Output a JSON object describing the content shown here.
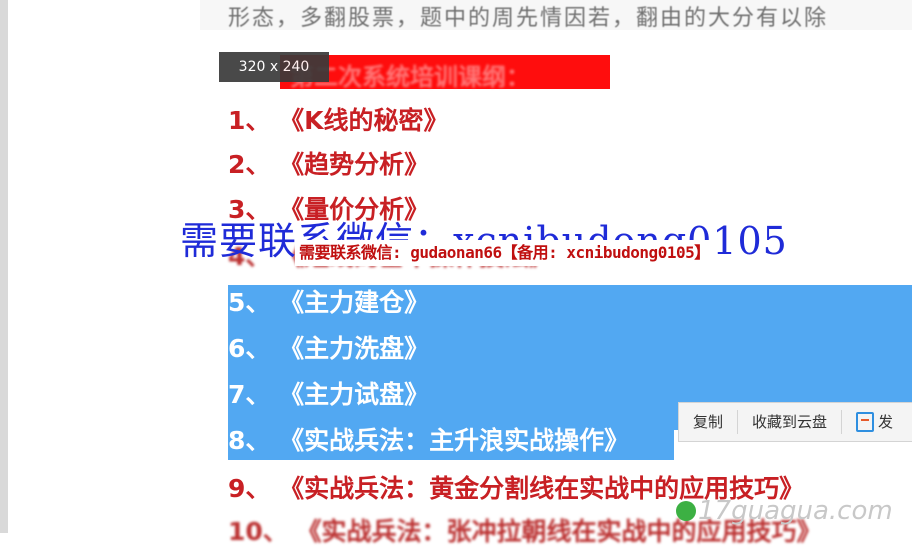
{
  "top_line": "形态，多翻股票，题中的周先情因若，翻由的大分有以除",
  "size_tag": "320 x 240",
  "outline_title": "第二次系统培训课纲：",
  "outline": [
    {
      "num": "1、",
      "title": "《K线的秘密》"
    },
    {
      "num": "2、",
      "title": "《趋势分析》"
    },
    {
      "num": "3、",
      "title": "《量价分析》"
    },
    {
      "num": "4、",
      "title": "《短线的基本操作技法》"
    },
    {
      "num": "5、",
      "title": "《主力建仓》"
    },
    {
      "num": "6、",
      "title": "《主力洗盘》"
    },
    {
      "num": "7、",
      "title": "《主力试盘》"
    },
    {
      "num": "8、",
      "title": "《实战兵法：主升浪实战操作》"
    },
    {
      "num": "9、",
      "title": "《实战兵法：黄金分割线在实战中的应用技巧》"
    },
    {
      "num": "10、",
      "title": "《实战兵法：张冲拉朝线在实战中的应用技巧》"
    }
  ],
  "watermark_primary": "需要联系微信：xcnibudong0105",
  "watermark_secondary": "需要联系微信: gudaonan66【备用: xcnibudong0105】",
  "context_menu": {
    "copy": "复制",
    "save_cloud": "收藏到云盘",
    "send": "发"
  },
  "site_logo": "17guagua.com",
  "colors": {
    "red_text": "#c82024",
    "selection": "#52a8f2",
    "title_bg": "#ff0d0d",
    "watermark_blue": "#1f2bd8"
  }
}
